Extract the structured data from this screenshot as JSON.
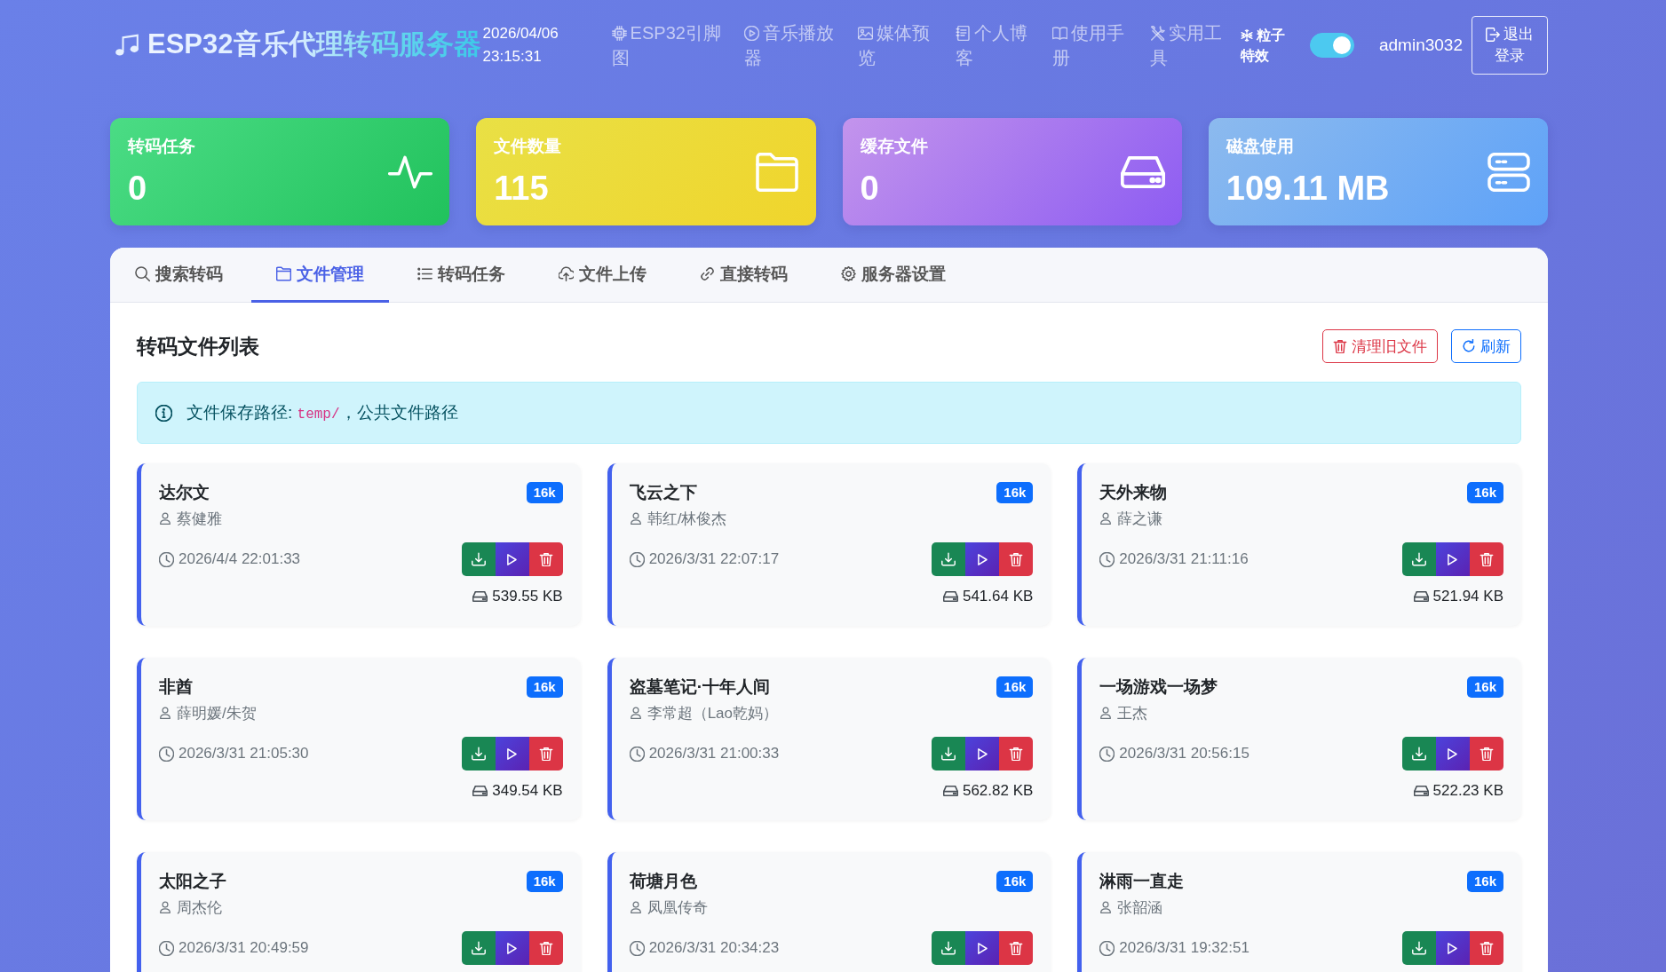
{
  "header": {
    "logo": "ESP32音乐代理转码服务器",
    "date": "2026/04/06",
    "clock": "23:15:31",
    "nav": [
      "ESP32引脚图",
      "音乐播放器",
      "媒体预览",
      "个人博客",
      "使用手册",
      "实用工具"
    ],
    "particles": {
      "label": "粒子特效",
      "on": true
    },
    "user": "admin3032",
    "logout": "退出登录"
  },
  "stats": [
    {
      "label": "转码任务",
      "value": "0"
    },
    {
      "label": "文件数量",
      "value": "115"
    },
    {
      "label": "缓存文件",
      "value": "0"
    },
    {
      "label": "磁盘使用",
      "value": "109.11 MB"
    }
  ],
  "tabs": [
    {
      "label": "搜索转码",
      "selected": false
    },
    {
      "label": "文件管理",
      "selected": true
    },
    {
      "label": "转码任务",
      "selected": false
    },
    {
      "label": "文件上传",
      "selected": false
    },
    {
      "label": "直接转码",
      "selected": false
    },
    {
      "label": "服务器设置",
      "selected": false
    }
  ],
  "file_list": {
    "title": "转码文件列表",
    "actions": [
      {
        "label": "清理旧文件",
        "kind": "danger"
      },
      {
        "label": "刷新",
        "kind": "primary"
      }
    ],
    "info": {
      "text": "文件保存路径: ",
      "path": "temp/",
      "after": "，公共文件路径"
    },
    "files": [
      {
        "title": "达尔文",
        "bitrate": "16k",
        "artist": "蔡健雅",
        "time": "2026/4/4 22:01:33",
        "size": "539.55 KB"
      },
      {
        "title": "飞云之下",
        "bitrate": "16k",
        "artist": "韩红/林俊杰",
        "time": "2026/3/31 22:07:17",
        "size": "541.64 KB"
      },
      {
        "title": "天外来物",
        "bitrate": "16k",
        "artist": "薛之谦",
        "time": "2026/3/31 21:11:16",
        "size": "521.94 KB"
      },
      {
        "title": "非酋",
        "bitrate": "16k",
        "artist": "薛明媛/朱贺",
        "time": "2026/3/31 21:05:30",
        "size": "349.54 KB"
      },
      {
        "title": "盗墓笔记·十年人间",
        "bitrate": "16k",
        "artist": "李常超（Lao乾妈）",
        "time": "2026/3/31 21:00:33",
        "size": "562.82 KB"
      },
      {
        "title": "一场游戏一场梦",
        "bitrate": "16k",
        "artist": "王杰",
        "time": "2026/3/31 20:56:15",
        "size": "522.23 KB"
      },
      {
        "title": "太阳之子",
        "bitrate": "16k",
        "artist": "周杰伦",
        "time": "2026/3/31 20:49:59"
      },
      {
        "title": "荷塘月色",
        "bitrate": "16k",
        "artist": "凤凰传奇",
        "time": "2026/3/31 20:34:23"
      },
      {
        "title": "淋雨一直走",
        "bitrate": "16k",
        "artist": "张韶涵",
        "time": "2026/3/31 19:32:51"
      }
    ]
  }
}
